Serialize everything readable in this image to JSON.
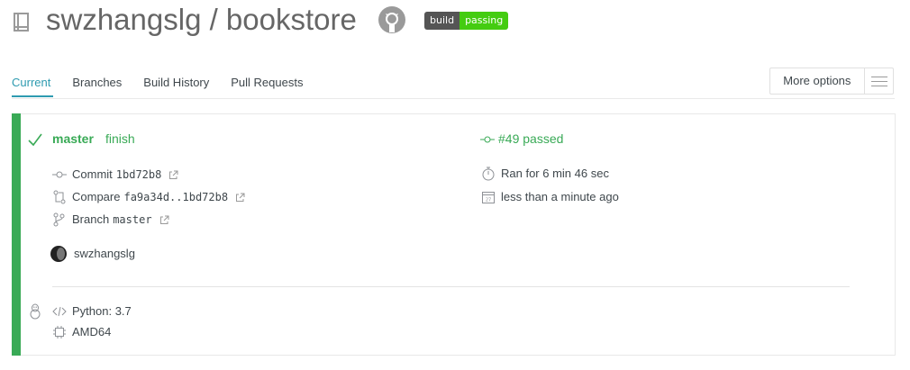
{
  "header": {
    "repo_title": "swzhangslg / bookstore",
    "badge_left": "build",
    "badge_right": "passing"
  },
  "tabs": [
    {
      "label": "Current"
    },
    {
      "label": "Branches"
    },
    {
      "label": "Build History"
    },
    {
      "label": "Pull Requests"
    }
  ],
  "more_options": {
    "label": "More options"
  },
  "build": {
    "status": "passed",
    "branch": "master",
    "message": "finish",
    "number_label": "#49 passed",
    "commit_label": "Commit",
    "commit_sha": "1bd72b8",
    "compare_label": "Compare",
    "compare_range": "fa9a34d..1bd72b8",
    "branch_label": "Branch",
    "branch_value": "master",
    "duration": "Ran for 6 min 46 sec",
    "finished": "less than a minute ago",
    "author": "swzhangslg",
    "language": "Python: 3.7",
    "arch": "AMD64"
  },
  "colors": {
    "passed": "#39aa56",
    "tab_active": "#2e9bb0"
  }
}
